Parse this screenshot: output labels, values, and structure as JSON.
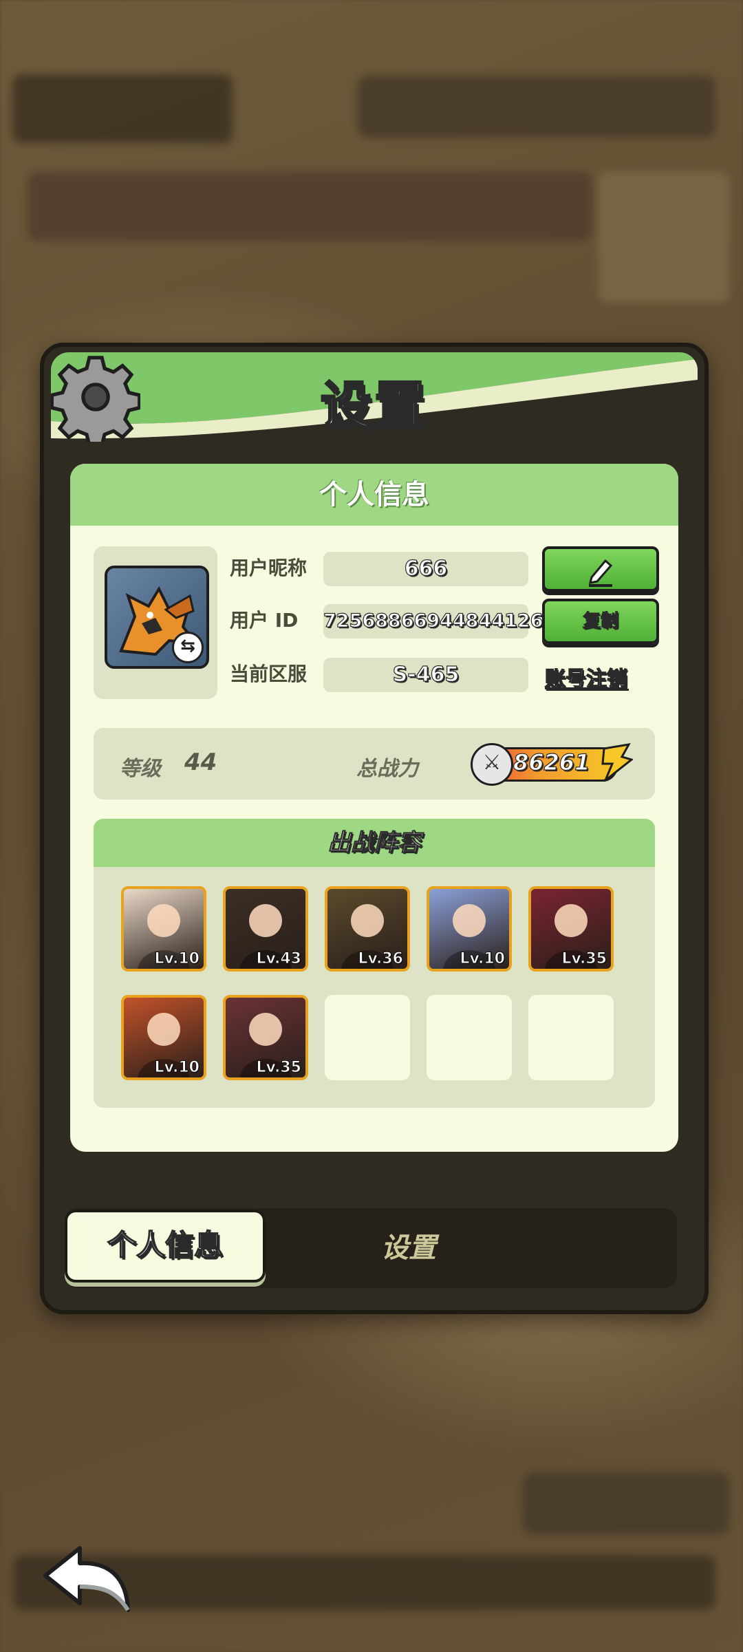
{
  "panel": {
    "title": "设置"
  },
  "profile_card": {
    "header": "个人信息",
    "nickname_label": "用户昵称",
    "nickname_value": "666",
    "id_label": "用户 ID",
    "id_value": "7256886694484412б",
    "server_label": "当前区服",
    "server_value": "S-465",
    "copy_button": "复制",
    "deactivate_link": "账号注销",
    "level_label": "等级",
    "level_value": "44",
    "power_label": "总战力",
    "power_value": "86261"
  },
  "lineup": {
    "header": "出战阵容",
    "heroes": [
      {
        "level": "Lv.10",
        "color": "#e9d9c7"
      },
      {
        "level": "Lv.43",
        "color": "#3b2e25"
      },
      {
        "level": "Lv.36",
        "color": "#5a4a2c"
      },
      {
        "level": "Lv.10",
        "color": "#8aa0d8"
      },
      {
        "level": "Lv.35",
        "color": "#7a2430"
      },
      {
        "level": "Lv.10",
        "color": "#c2522a"
      },
      {
        "level": "Lv.35",
        "color": "#6a3236"
      }
    ],
    "empty_slots": 3
  },
  "tabs": {
    "personal": "个人信息",
    "settings": "设置"
  },
  "colors": {
    "accent_green": "#7fc869",
    "card_bg": "#f7fbe0",
    "frame_gold": "#e8a21e"
  }
}
